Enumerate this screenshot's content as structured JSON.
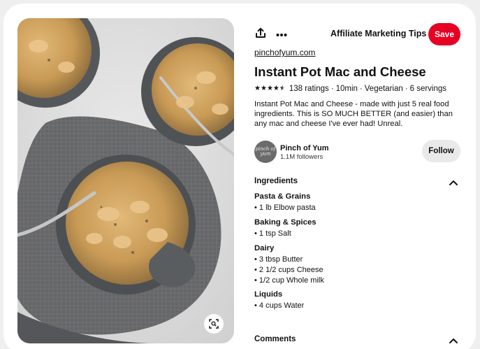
{
  "board_select": {
    "label": "Affiliate Marketing Tips"
  },
  "save_label": "Save",
  "source": "pinchofyum.com",
  "title": "Instant Pot Mac and Cheese",
  "meta": {
    "rating_stars": 4.5,
    "ratings": "138 ratings",
    "sep1": "·",
    "time": "10min",
    "sep2": "·",
    "diet": "Vegetarian",
    "sep3": "·",
    "servings": "6 servings"
  },
  "description": "Instant Pot Mac and Cheese - made with just 5 real food ingredients. This is SO MUCH BETTER (and easier) than any mac and cheese I've ever had! Unreal.",
  "author": {
    "avatar_text": "pinch of yum",
    "name": "Pinch of Yum",
    "followers": "1.1M followers",
    "follow_label": "Follow"
  },
  "ingredients": {
    "heading": "Ingredients",
    "groups": [
      {
        "title": "Pasta & Grains",
        "items": [
          "• 1 lb Elbow pasta"
        ]
      },
      {
        "title": "Baking & Spices",
        "items": [
          "• 1 tsp Salt"
        ]
      },
      {
        "title": "Dairy",
        "items": [
          "• 3 tbsp Butter",
          "• 2 1/2 cups Cheese",
          "• 1/2 cup Whole milk"
        ]
      },
      {
        "title": "Liquids",
        "items": [
          "• 4 cups Water"
        ]
      }
    ]
  },
  "comments": {
    "heading": "Comments"
  },
  "icons": {
    "share": "share-icon",
    "more": "more-options-icon",
    "board_chevron": "chevron-down-icon",
    "visual_search": "visual-search-icon",
    "collapse": "chevron-up-icon",
    "star": "star-icon"
  },
  "colors": {
    "save": "#e60023",
    "follow_bg": "#e9e9e9",
    "text": "#111111"
  }
}
